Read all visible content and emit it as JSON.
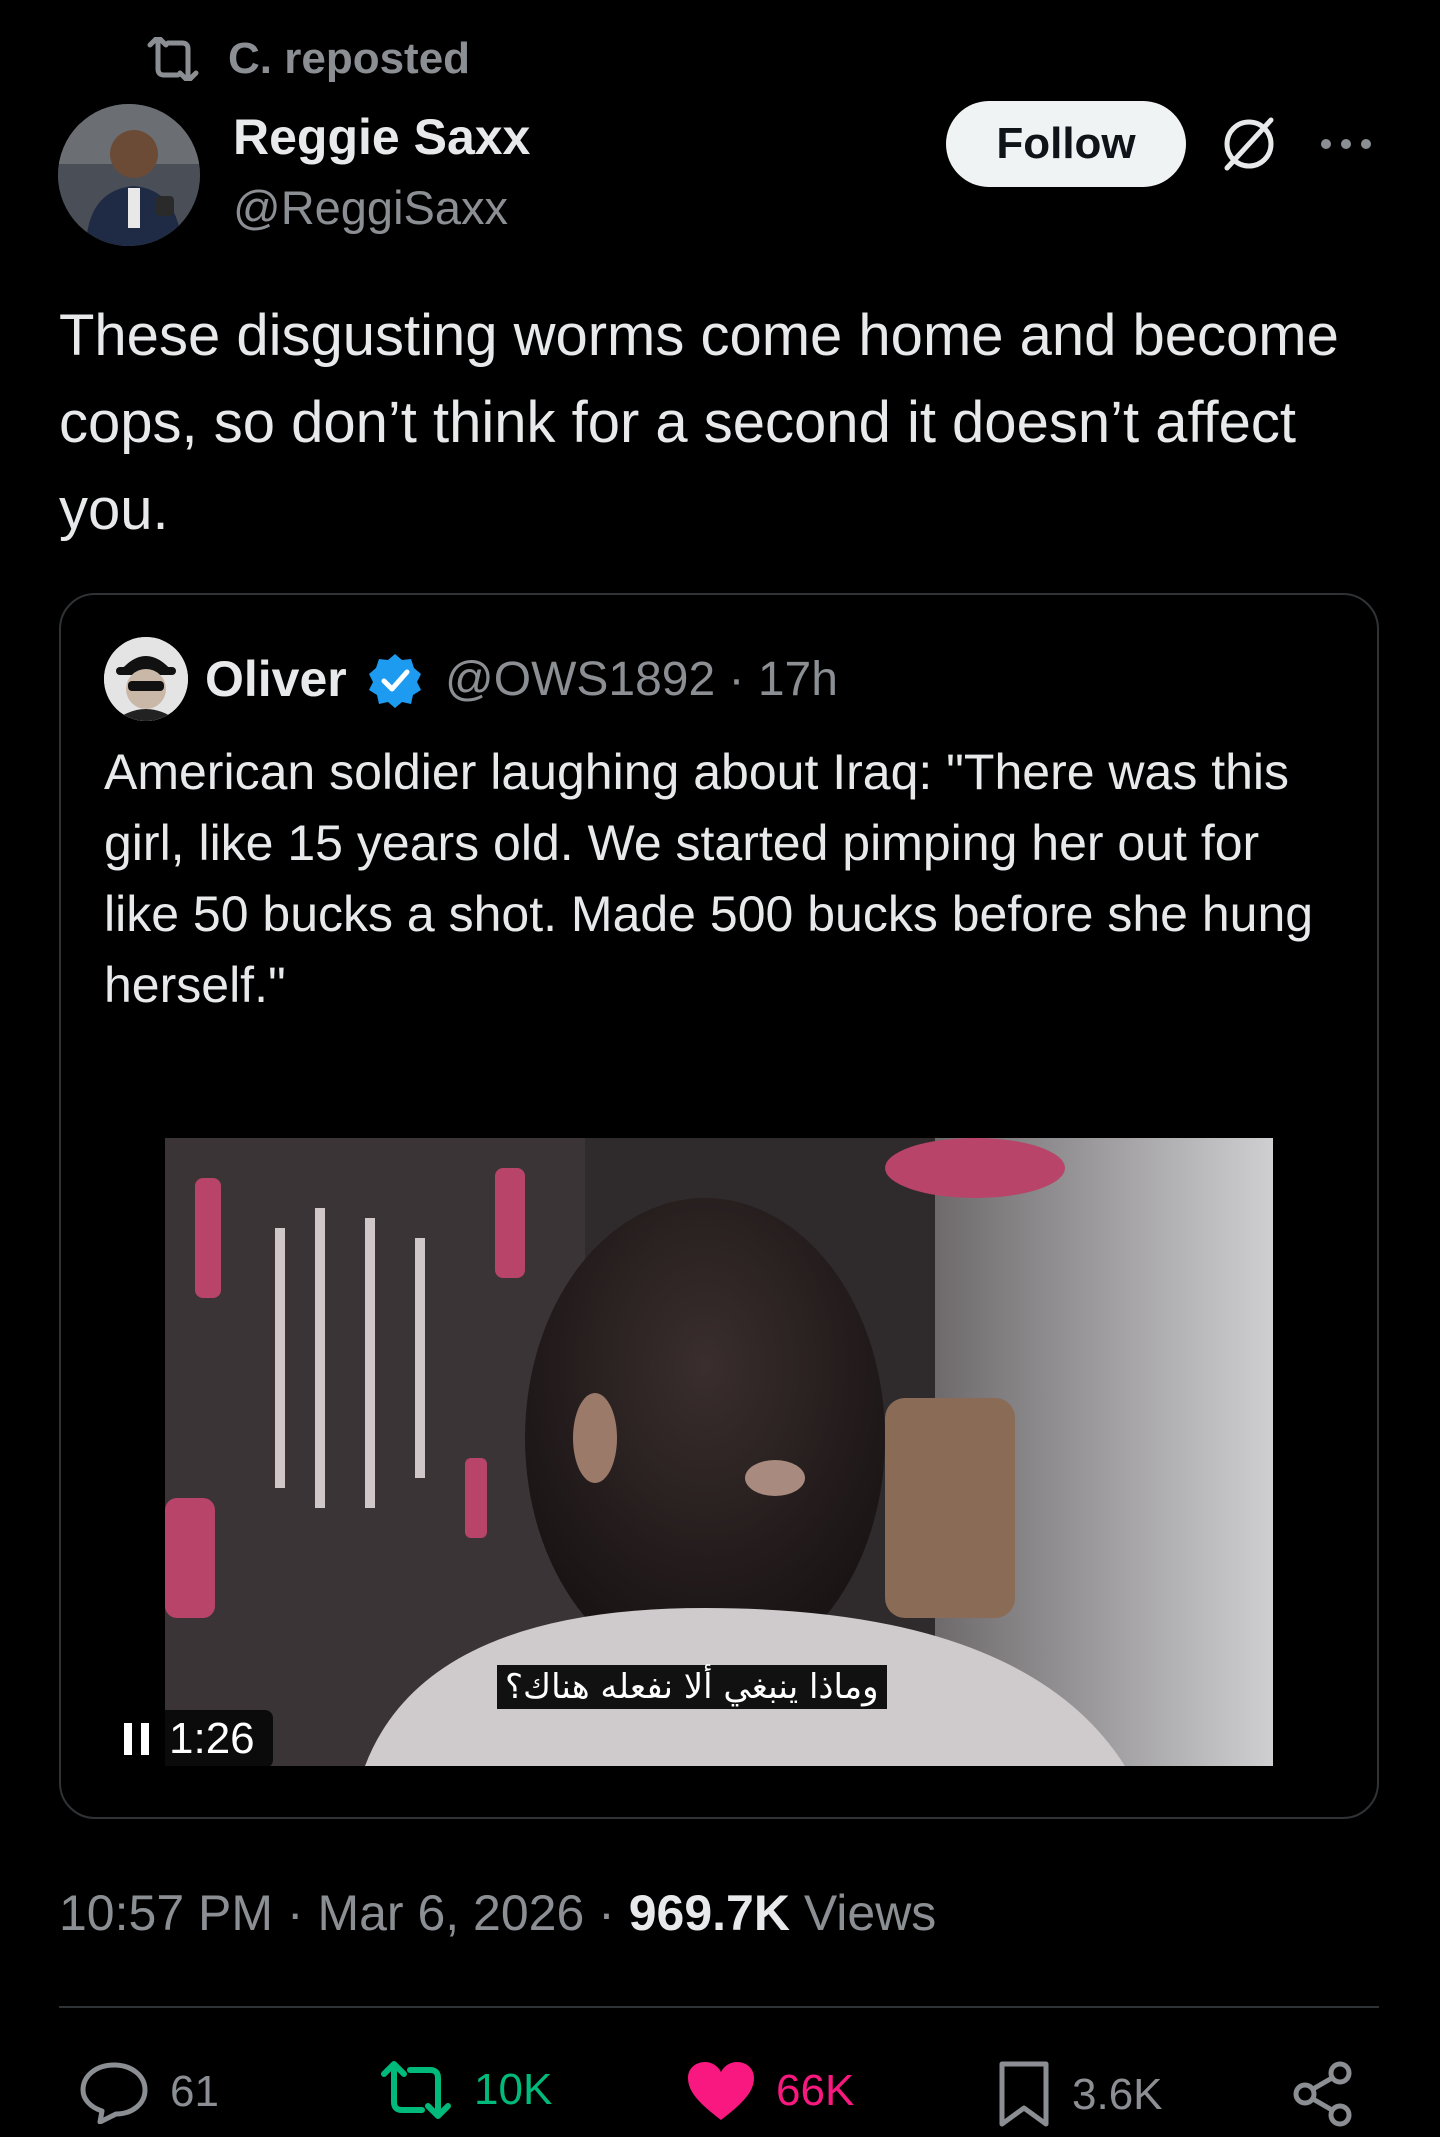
{
  "repost": {
    "text": "C. reposted",
    "icon": "repost-icon"
  },
  "author": {
    "name": "Reggie Saxx",
    "handle": "@ReggiSaxx",
    "avatar": "avatar"
  },
  "follow_button": "Follow",
  "icons": {
    "grok": "grok-icon",
    "more": "more-icon"
  },
  "post": {
    "text": "These disgusting worms come home and become cops, so don’t think for a second it doesn’t affect you."
  },
  "quote": {
    "name": "Oliver",
    "handle_time": "@OWS1892 · 17h",
    "verified": true,
    "text": "American soldier laughing about Iraq: \"There was this girl, like 15 years old. We started pimping her out for like 50 bucks a shot. Made 500 bucks before she hung herself.\"",
    "video": {
      "subtitle": "وماذا ينبغي ألا نفعله هناك؟",
      "timer": "1:26"
    }
  },
  "meta": {
    "time_date": "10:57 PM · Mar 6, 2026 · ",
    "views_count": "969.7K",
    "views_label": " Views"
  },
  "actions": {
    "replies": "61",
    "reposts": "10K",
    "likes": "66K",
    "bookmarks": "3.6K"
  },
  "colors": {
    "background": "#000000",
    "text": "#e7e9ea",
    "muted": "#8b8f93",
    "repost_green": "#00ba7c",
    "like_pink": "#f91880",
    "verified_blue": "#1d9bf0",
    "border": "#2f3336"
  }
}
